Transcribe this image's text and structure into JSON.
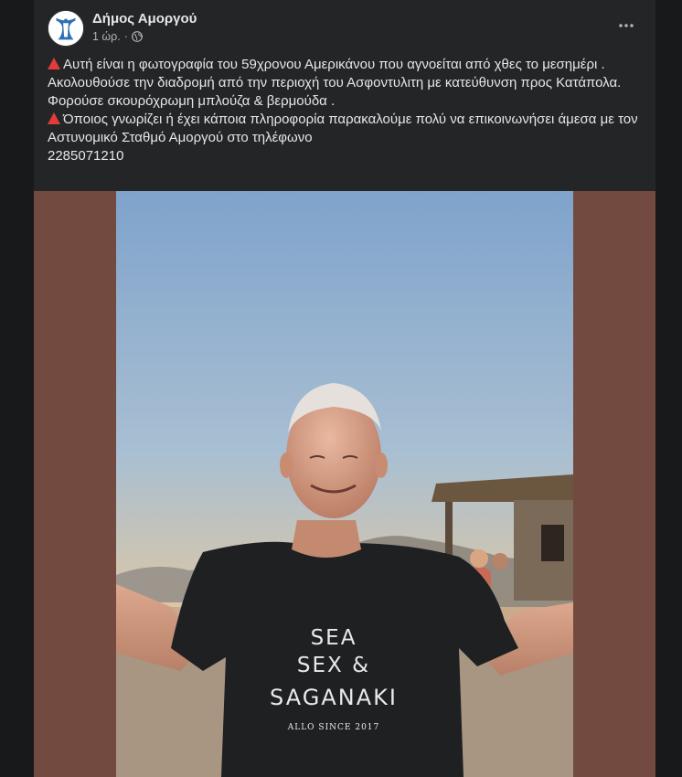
{
  "post": {
    "page_name": "Δήμος Αμοργού",
    "time": "1 ώρ.",
    "separator": "·",
    "more_icon": "more-horizontal-icon",
    "audience_icon": "globe-icon",
    "text_line1": "Αυτή είναι η φωτογραφία του 59χρονου Αμερικάνου που αγνοείται από χθες το μεσημέρι .",
    "text_line2": "Ακολουθούσε την διαδρομή από την περιοχή του Ασφοντυλιτη με κατεύθυνση προς Κατάπολα.",
    "text_line3": "Φορούσε σκουρόχρωμη μπλούζα & βερμούδα .",
    "text_line4": "Όποιος γνωρίζει ή έχει κάποια πληροφορία παρακαλούμε πολύ να επικοινωνήσει άμεσα με τον Αστυνομικό Σταθμό Αμοργού στο τηλέφωνο",
    "phone": "2285071210",
    "warning_icon": "red-triangle-icon"
  },
  "photo": {
    "shirt_line1": "SEA",
    "shirt_line2": "SEX &",
    "shirt_line3": "SAGANAKI",
    "shirt_line4": "ALLO SINCE 2017"
  },
  "colors": {
    "background": "#18191a",
    "card": "#242526",
    "photo_frame": "#734a40",
    "text": "#e4e6eb",
    "secondary_text": "#b0b3b8",
    "warning": "#e23b3b"
  }
}
